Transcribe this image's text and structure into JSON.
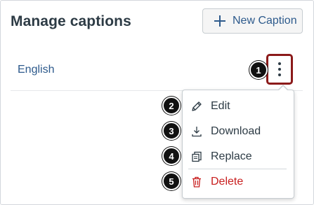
{
  "header": {
    "title": "Manage captions",
    "new_caption_label": "New Caption"
  },
  "captions": {
    "rows": [
      {
        "language": "English"
      }
    ]
  },
  "menu": {
    "items": [
      {
        "label": "Edit",
        "icon": "pencil-icon"
      },
      {
        "label": "Download",
        "icon": "download-icon"
      },
      {
        "label": "Replace",
        "icon": "replace-icon"
      },
      {
        "label": "Delete",
        "icon": "trash-icon"
      }
    ]
  },
  "callouts": [
    "1",
    "2",
    "3",
    "4",
    "5"
  ],
  "colors": {
    "link": "#2d5a8c",
    "danger": "#c81e1e",
    "callout_highlight": "#8b1a1a",
    "text": "#2d3b45"
  }
}
